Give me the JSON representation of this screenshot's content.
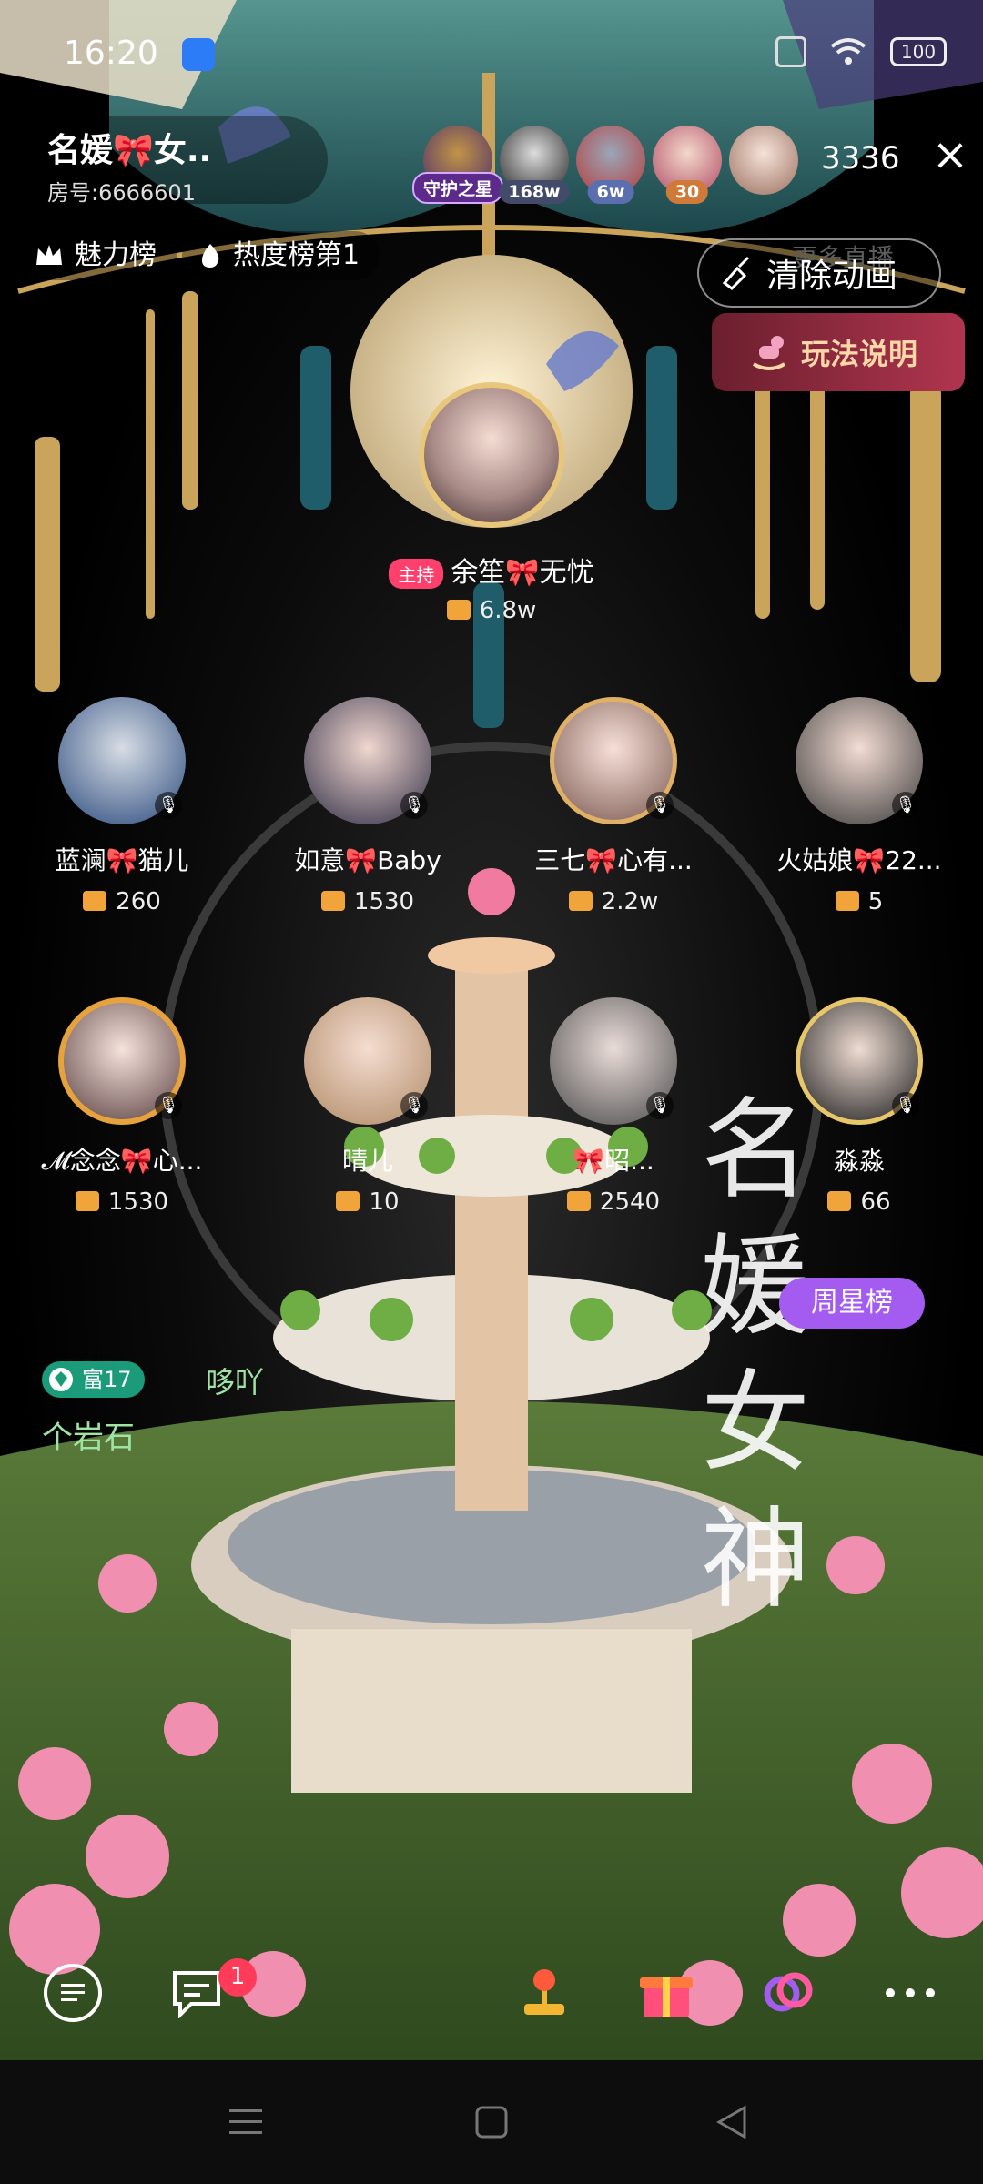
{
  "status_bar": {
    "time": "16:20",
    "battery": "100"
  },
  "room": {
    "title": "名媛🎀女..",
    "room_id": "房号:6666601"
  },
  "guards": [
    {
      "tag": "守护之星",
      "tag_color": "#5b2a8a"
    },
    {
      "tag": "168w",
      "tag_color": "#444a6a"
    },
    {
      "tag": "6w",
      "tag_color": "#5b6fb0"
    },
    {
      "tag": "30",
      "tag_color": "#d07a3a"
    }
  ],
  "viewer_count": "3336",
  "chips": {
    "charm": "魅力榜",
    "heat": "热度榜第1"
  },
  "more_live": "更多直播",
  "clear_animation": "清除动画",
  "rules": "玩法说明",
  "host": {
    "role": "主持",
    "name": "余笙🎀无忧",
    "gift": "6.8w"
  },
  "seats": [
    {
      "name": "蓝澜🎀猫儿",
      "gift": "260"
    },
    {
      "name": "如意🎀Baby",
      "gift": "1530"
    },
    {
      "name": "三七🎀心有...",
      "gift": "2.2w"
    },
    {
      "name": "火姑娘🎀22...",
      "gift": "5"
    },
    {
      "name": "𝓜念念🎀心...",
      "gift": "1530"
    },
    {
      "name": "晴儿",
      "gift": "10"
    },
    {
      "name": "🎀昭...",
      "gift": "2540"
    },
    {
      "name": "淼淼",
      "gift": "66"
    }
  ],
  "week_star": "周星榜",
  "brand_text": "名媛女神",
  "user_level": "富17",
  "user_msg1": "哆吖",
  "user_msg2": "个岩石",
  "toolbar": {
    "message_badge": "1"
  },
  "colors": {
    "accent": "#a45bf0",
    "host_tag": "#ff3f6c",
    "level": "#1c9b7a"
  }
}
